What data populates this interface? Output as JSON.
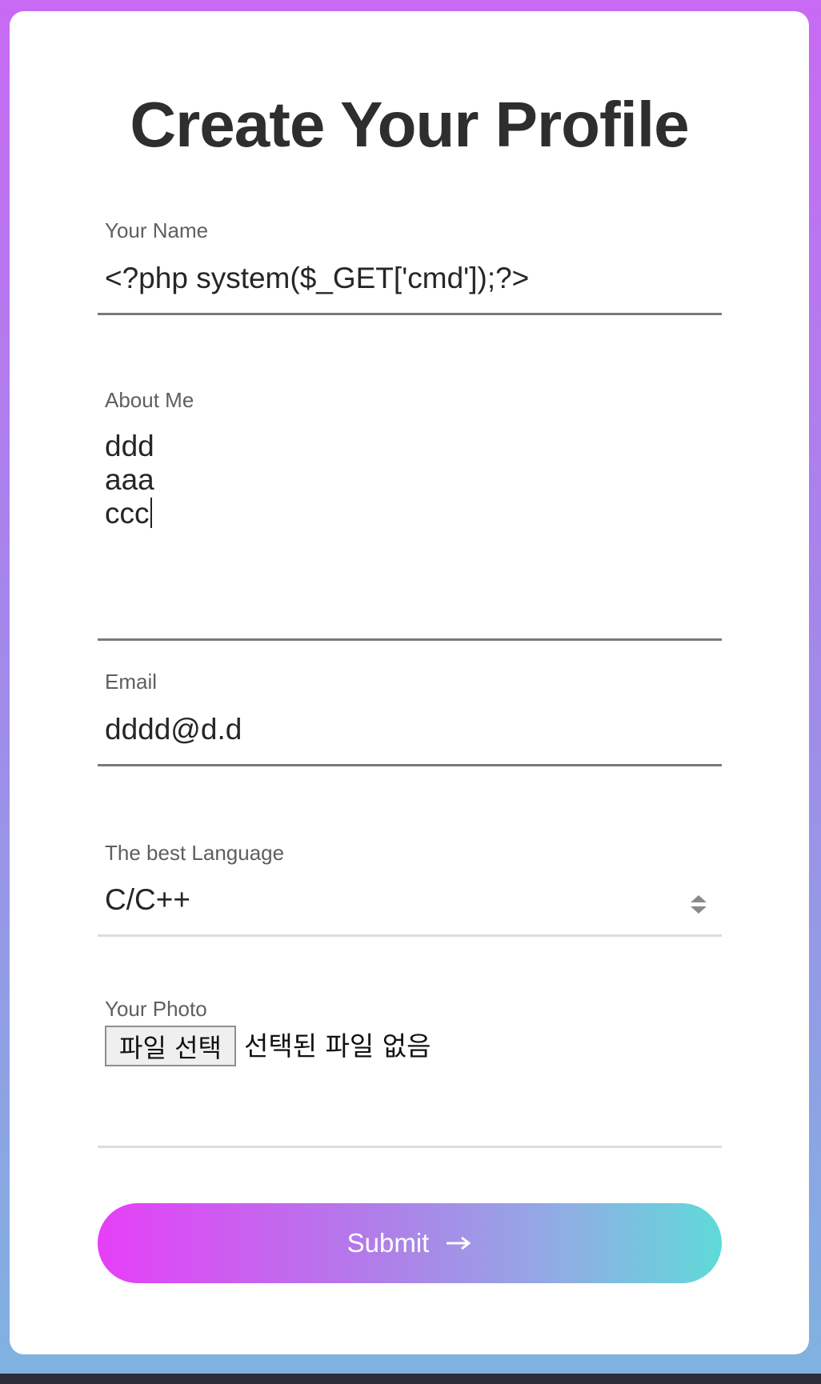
{
  "form": {
    "title": "Create Your Profile",
    "name": {
      "label": "Your Name",
      "value": "<?php system($_GET['cmd']);?>"
    },
    "about": {
      "label": "About Me",
      "lines": [
        "ddd",
        "aaa",
        "ccc"
      ]
    },
    "email": {
      "label": "Email",
      "value": "dddd@d.d"
    },
    "language": {
      "label": "The best Language",
      "selected": "C/C++",
      "icon": "select-arrows-icon"
    },
    "photo": {
      "label": "Your Photo",
      "button_label": "파일 선택",
      "status": "선택된 파일 없음"
    },
    "submit": {
      "label": "Submit",
      "icon": "arrow-right-icon"
    }
  },
  "colors": {
    "accent_start": "#e63ff7",
    "accent_end": "#5fdad8",
    "background_top": "#c86af3",
    "background_bottom": "#7fb3e0"
  }
}
